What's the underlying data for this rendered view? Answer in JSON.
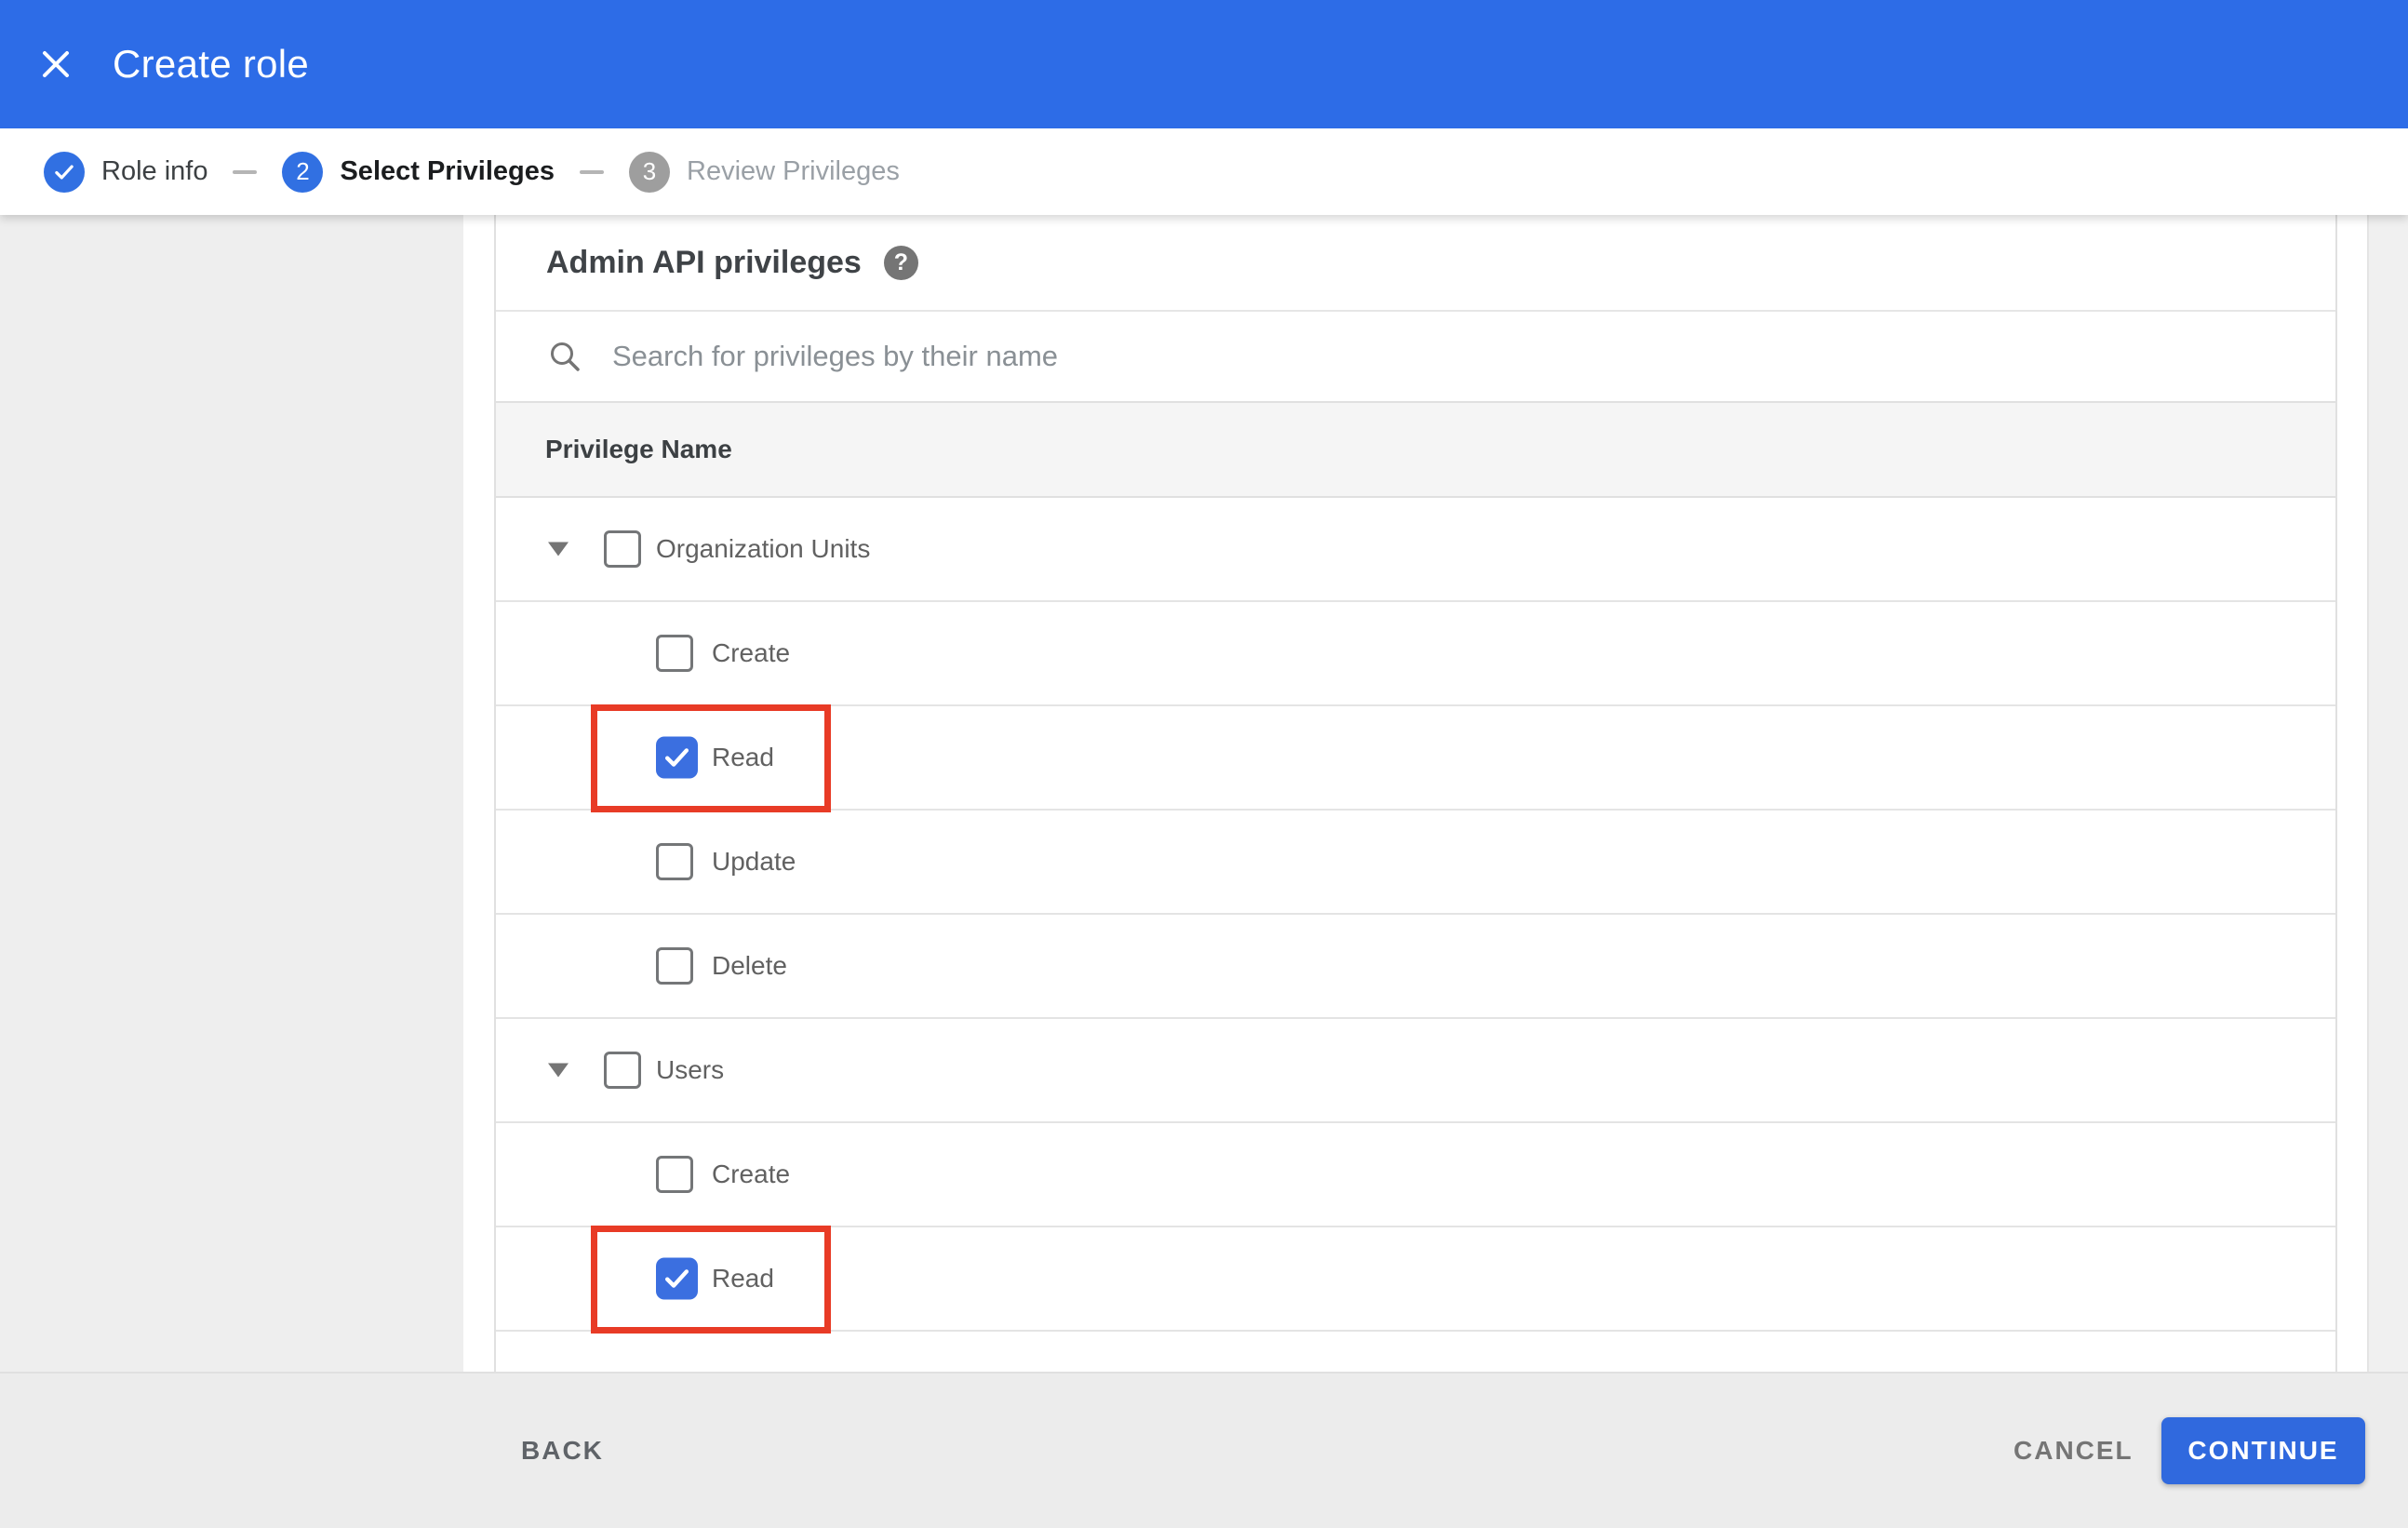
{
  "appbar": {
    "title": "Create role",
    "close_icon": "x-icon"
  },
  "stepper": {
    "steps": [
      {
        "label": "Role info",
        "state": "complete",
        "icon": "check"
      },
      {
        "number": "2",
        "label": "Select Privileges",
        "state": "active"
      },
      {
        "number": "3",
        "label": "Review Privileges",
        "state": "upcoming"
      }
    ]
  },
  "panel": {
    "heading": "Admin API privileges",
    "help_icon": "?",
    "search": {
      "value": "",
      "placeholder": "Search for privileges by their name"
    },
    "table_header": "Privilege Name",
    "rows": [
      {
        "type": "parent",
        "label": "Organization Units",
        "checked": false,
        "expanded": true,
        "highlighted": false
      },
      {
        "type": "child",
        "label": "Create",
        "checked": false,
        "highlighted": false
      },
      {
        "type": "child",
        "label": "Read",
        "checked": true,
        "highlighted": true
      },
      {
        "type": "child",
        "label": "Update",
        "checked": false,
        "highlighted": false
      },
      {
        "type": "child",
        "label": "Delete",
        "checked": false,
        "highlighted": false
      },
      {
        "type": "parent",
        "label": "Users",
        "checked": false,
        "expanded": true,
        "highlighted": false
      },
      {
        "type": "child",
        "label": "Create",
        "checked": false,
        "highlighted": false
      },
      {
        "type": "child",
        "label": "Read",
        "checked": true,
        "highlighted": true
      }
    ]
  },
  "footer": {
    "back_label": "BACK",
    "cancel_label": "CANCEL",
    "continue_label": "CONTINUE"
  },
  "colors": {
    "appbar_blue": "#2d6ce7",
    "accent_blue": "#3170e2",
    "checkbox_blue": "#3b6fe0",
    "button_blue": "#3069de",
    "annotation_red": "#e83b26",
    "inactive_gray": "#9e9e9e"
  }
}
